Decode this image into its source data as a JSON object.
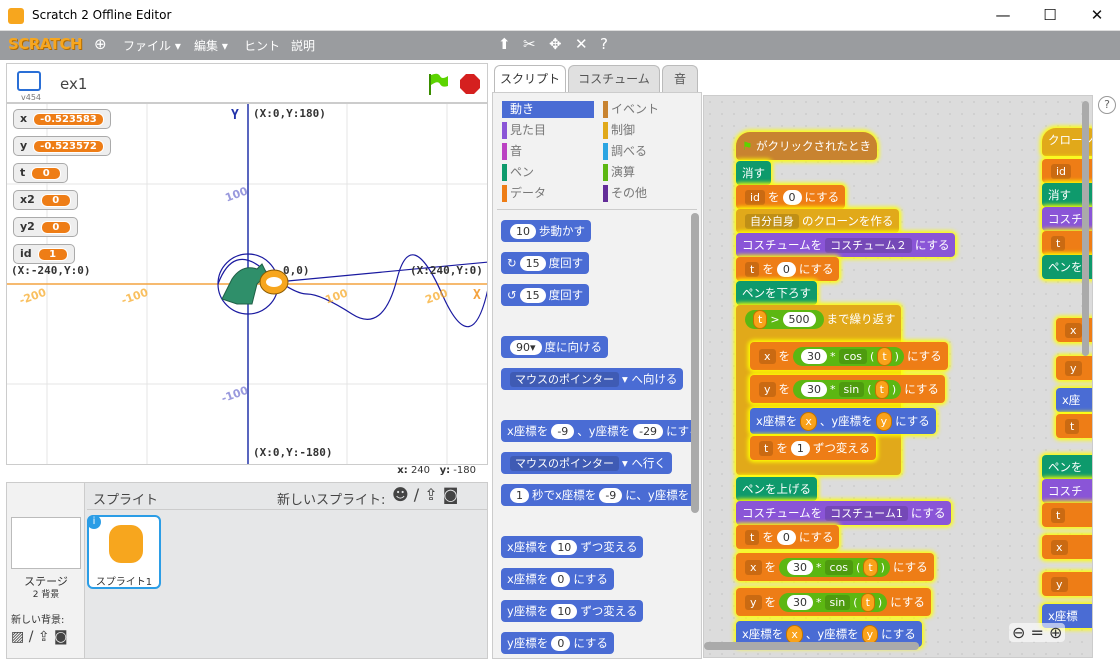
{
  "window": {
    "title": "Scratch 2 Offline Editor",
    "min": "—",
    "max": "☐",
    "close": "✕"
  },
  "menu": {
    "logo": "SCRATCH",
    "file": "ファイル ▾",
    "edit": "編集 ▾",
    "hint": "ヒント",
    "about": "説明"
  },
  "stage": {
    "project": "ex1",
    "version": "v454",
    "monitors": [
      {
        "label": "x",
        "value": "-0.523583"
      },
      {
        "label": "y",
        "value": "-0.523572"
      },
      {
        "label": "t",
        "value": "0"
      },
      {
        "label": "x2",
        "value": "0"
      },
      {
        "label": "y2",
        "value": "0"
      },
      {
        "label": "id",
        "value": "1"
      }
    ],
    "labels": {
      "top": "(X:0,Y:180)",
      "bottom": "(X:0,Y:-180)",
      "left": "(X:-240,Y:0)",
      "right": "(X:240,Y:0)",
      "center": "0,0)",
      "x": "X",
      "y": "Y"
    },
    "ticks_x": [
      "-200",
      "-100",
      "100",
      "200"
    ],
    "ticks_y": [
      "100",
      "-100"
    ],
    "mouse": {
      "x": "240",
      "y": "-180"
    }
  },
  "sprites": {
    "title": "スプライト",
    "new_sprite": "新しいスプライト:",
    "stage_label": "ステージ",
    "backdrops": "2 背景",
    "new_backdrop": "新しい背景:",
    "sprite1": "スプライト1"
  },
  "tabs": [
    "スクリプト",
    "コスチューム",
    "音"
  ],
  "categories": {
    "left": [
      "動き",
      "見た目",
      "音",
      "ペン",
      "データ"
    ],
    "right": [
      "イベント",
      "制御",
      "調べる",
      "演算",
      "その他"
    ]
  },
  "palette": {
    "move": {
      "n": "10",
      "t": "歩動かす"
    },
    "turn_r": {
      "n": "15",
      "t": "度回す"
    },
    "turn_l": {
      "n": "15",
      "t": "度回す"
    },
    "point_dir": {
      "n": "90▾",
      "t": "度に向ける"
    },
    "point_to": {
      "d": "マウスのポインター",
      "t": "へ向ける"
    },
    "goto_xy": {
      "a": "x座標を",
      "n1": "-9",
      "b": "、y座標を",
      "n2": "-29",
      "c": "にする"
    },
    "goto": {
      "d": "マウスのポインター",
      "t": "へ行く"
    },
    "glide": {
      "n": "1",
      "a": "秒でx座標を",
      "n1": "-9",
      "b": "に、y座標を"
    },
    "change_x": {
      "a": "x座標を",
      "n": "10",
      "b": "ずつ変える"
    },
    "set_x": {
      "a": "x座標を",
      "n": "0",
      "b": "にする"
    },
    "change_y": {
      "a": "y座標を",
      "n": "10",
      "b": "ずつ変える"
    },
    "set_y": {
      "a": "y座標を",
      "n": "0",
      "b": "にする"
    }
  },
  "script": {
    "hat": "がクリックされたとき",
    "clear": "消す",
    "set_id": {
      "d": "id",
      "a": "を",
      "n": "0",
      "b": "にする"
    },
    "clone": {
      "d": "自分自身",
      "b": "のクローンを作る"
    },
    "costume2": {
      "a": "コスチュームを",
      "d": "コスチューム２",
      "b": "にする"
    },
    "set_t": {
      "d": "t",
      "a": "を",
      "n": "0",
      "b": "にする"
    },
    "pen_down": "ペンを下ろす",
    "repeat": {
      "v": "t",
      "op": ">",
      "n": "500",
      "b": "まで繰り返す"
    },
    "set_x": {
      "d": "x",
      "a": "を",
      "n": "30",
      "op": "*",
      "f": "cos",
      "v": "t",
      "b": "にする"
    },
    "set_y": {
      "d": "y",
      "a": "を",
      "n": "30",
      "op": "*",
      "f": "sin",
      "v": "t",
      "b": "にする"
    },
    "goto": {
      "a": "x座標を",
      "v1": "x",
      "b": "、y座標を",
      "v2": "y",
      "c": "にする"
    },
    "change_t": {
      "d": "t",
      "a": "を",
      "n": "1",
      "b": "ずつ変える"
    },
    "pen_up": "ペンを上げる",
    "costume1": {
      "a": "コスチュームを",
      "d": "コスチューム1",
      "b": "にする"
    },
    "set_t2": {
      "d": "t",
      "a": "を",
      "n": "0",
      "b": "にする"
    },
    "set_x2": {
      "d": "x",
      "a": "を",
      "n": "30",
      "op": "*",
      "f": "cos",
      "v": "t",
      "b": "にする"
    },
    "set_y2": {
      "d": "y",
      "a": "を",
      "n": "30",
      "op": "*",
      "f": "sin",
      "v": "t",
      "b": "にする"
    },
    "goto2": {
      "a": "x座標を",
      "v1": "x",
      "b": "、y座標を",
      "v2": "y",
      "c": "にする"
    },
    "right_col": [
      "クローン",
      "id",
      "消す",
      "コスチ",
      "t",
      "ペンを",
      "x",
      "y",
      "x座",
      "t",
      "ペンを",
      "コスチ",
      "t",
      "x",
      "y",
      "x座標"
    ]
  }
}
